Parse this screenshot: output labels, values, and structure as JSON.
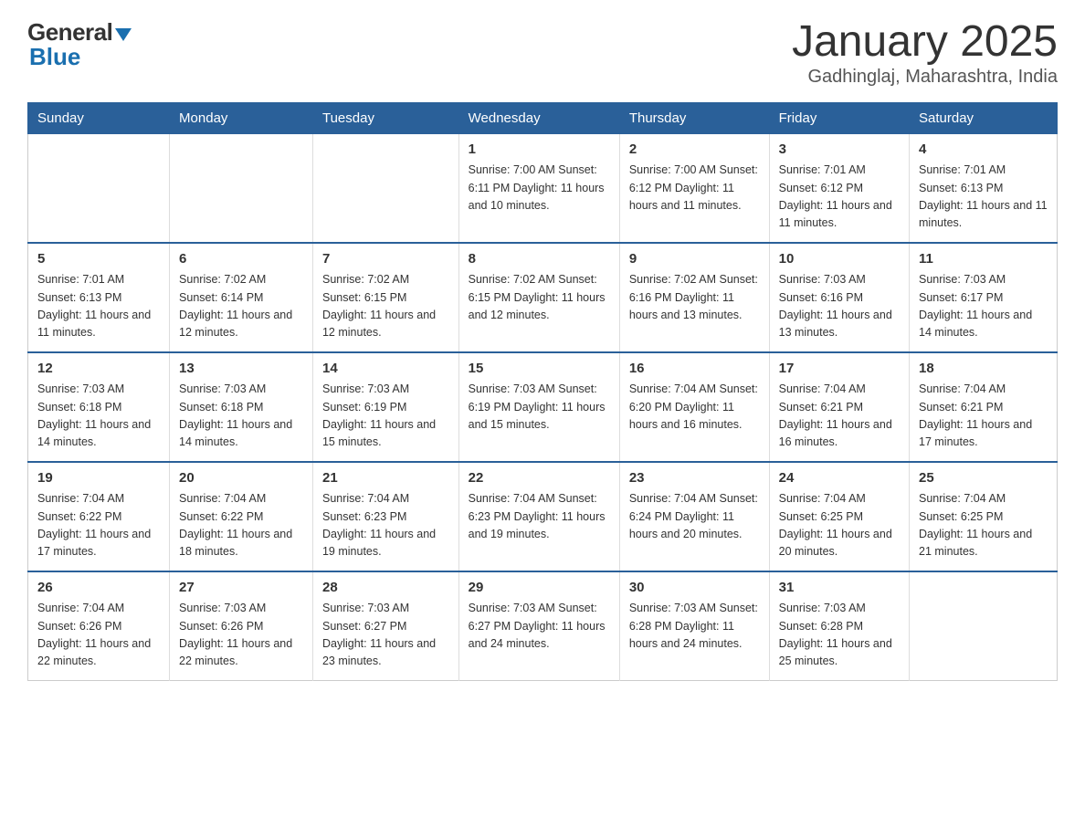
{
  "header": {
    "logo_general": "General",
    "logo_blue": "Blue",
    "month_title": "January 2025",
    "location": "Gadhinglaj, Maharashtra, India"
  },
  "days_of_week": [
    "Sunday",
    "Monday",
    "Tuesday",
    "Wednesday",
    "Thursday",
    "Friday",
    "Saturday"
  ],
  "weeks": [
    [
      {
        "day": "",
        "info": ""
      },
      {
        "day": "",
        "info": ""
      },
      {
        "day": "",
        "info": ""
      },
      {
        "day": "1",
        "info": "Sunrise: 7:00 AM\nSunset: 6:11 PM\nDaylight: 11 hours\nand 10 minutes."
      },
      {
        "day": "2",
        "info": "Sunrise: 7:00 AM\nSunset: 6:12 PM\nDaylight: 11 hours\nand 11 minutes."
      },
      {
        "day": "3",
        "info": "Sunrise: 7:01 AM\nSunset: 6:12 PM\nDaylight: 11 hours\nand 11 minutes."
      },
      {
        "day": "4",
        "info": "Sunrise: 7:01 AM\nSunset: 6:13 PM\nDaylight: 11 hours\nand 11 minutes."
      }
    ],
    [
      {
        "day": "5",
        "info": "Sunrise: 7:01 AM\nSunset: 6:13 PM\nDaylight: 11 hours\nand 11 minutes."
      },
      {
        "day": "6",
        "info": "Sunrise: 7:02 AM\nSunset: 6:14 PM\nDaylight: 11 hours\nand 12 minutes."
      },
      {
        "day": "7",
        "info": "Sunrise: 7:02 AM\nSunset: 6:15 PM\nDaylight: 11 hours\nand 12 minutes."
      },
      {
        "day": "8",
        "info": "Sunrise: 7:02 AM\nSunset: 6:15 PM\nDaylight: 11 hours\nand 12 minutes."
      },
      {
        "day": "9",
        "info": "Sunrise: 7:02 AM\nSunset: 6:16 PM\nDaylight: 11 hours\nand 13 minutes."
      },
      {
        "day": "10",
        "info": "Sunrise: 7:03 AM\nSunset: 6:16 PM\nDaylight: 11 hours\nand 13 minutes."
      },
      {
        "day": "11",
        "info": "Sunrise: 7:03 AM\nSunset: 6:17 PM\nDaylight: 11 hours\nand 14 minutes."
      }
    ],
    [
      {
        "day": "12",
        "info": "Sunrise: 7:03 AM\nSunset: 6:18 PM\nDaylight: 11 hours\nand 14 minutes."
      },
      {
        "day": "13",
        "info": "Sunrise: 7:03 AM\nSunset: 6:18 PM\nDaylight: 11 hours\nand 14 minutes."
      },
      {
        "day": "14",
        "info": "Sunrise: 7:03 AM\nSunset: 6:19 PM\nDaylight: 11 hours\nand 15 minutes."
      },
      {
        "day": "15",
        "info": "Sunrise: 7:03 AM\nSunset: 6:19 PM\nDaylight: 11 hours\nand 15 minutes."
      },
      {
        "day": "16",
        "info": "Sunrise: 7:04 AM\nSunset: 6:20 PM\nDaylight: 11 hours\nand 16 minutes."
      },
      {
        "day": "17",
        "info": "Sunrise: 7:04 AM\nSunset: 6:21 PM\nDaylight: 11 hours\nand 16 minutes."
      },
      {
        "day": "18",
        "info": "Sunrise: 7:04 AM\nSunset: 6:21 PM\nDaylight: 11 hours\nand 17 minutes."
      }
    ],
    [
      {
        "day": "19",
        "info": "Sunrise: 7:04 AM\nSunset: 6:22 PM\nDaylight: 11 hours\nand 17 minutes."
      },
      {
        "day": "20",
        "info": "Sunrise: 7:04 AM\nSunset: 6:22 PM\nDaylight: 11 hours\nand 18 minutes."
      },
      {
        "day": "21",
        "info": "Sunrise: 7:04 AM\nSunset: 6:23 PM\nDaylight: 11 hours\nand 19 minutes."
      },
      {
        "day": "22",
        "info": "Sunrise: 7:04 AM\nSunset: 6:23 PM\nDaylight: 11 hours\nand 19 minutes."
      },
      {
        "day": "23",
        "info": "Sunrise: 7:04 AM\nSunset: 6:24 PM\nDaylight: 11 hours\nand 20 minutes."
      },
      {
        "day": "24",
        "info": "Sunrise: 7:04 AM\nSunset: 6:25 PM\nDaylight: 11 hours\nand 20 minutes."
      },
      {
        "day": "25",
        "info": "Sunrise: 7:04 AM\nSunset: 6:25 PM\nDaylight: 11 hours\nand 21 minutes."
      }
    ],
    [
      {
        "day": "26",
        "info": "Sunrise: 7:04 AM\nSunset: 6:26 PM\nDaylight: 11 hours\nand 22 minutes."
      },
      {
        "day": "27",
        "info": "Sunrise: 7:03 AM\nSunset: 6:26 PM\nDaylight: 11 hours\nand 22 minutes."
      },
      {
        "day": "28",
        "info": "Sunrise: 7:03 AM\nSunset: 6:27 PM\nDaylight: 11 hours\nand 23 minutes."
      },
      {
        "day": "29",
        "info": "Sunrise: 7:03 AM\nSunset: 6:27 PM\nDaylight: 11 hours\nand 24 minutes."
      },
      {
        "day": "30",
        "info": "Sunrise: 7:03 AM\nSunset: 6:28 PM\nDaylight: 11 hours\nand 24 minutes."
      },
      {
        "day": "31",
        "info": "Sunrise: 7:03 AM\nSunset: 6:28 PM\nDaylight: 11 hours\nand 25 minutes."
      },
      {
        "day": "",
        "info": ""
      }
    ]
  ]
}
